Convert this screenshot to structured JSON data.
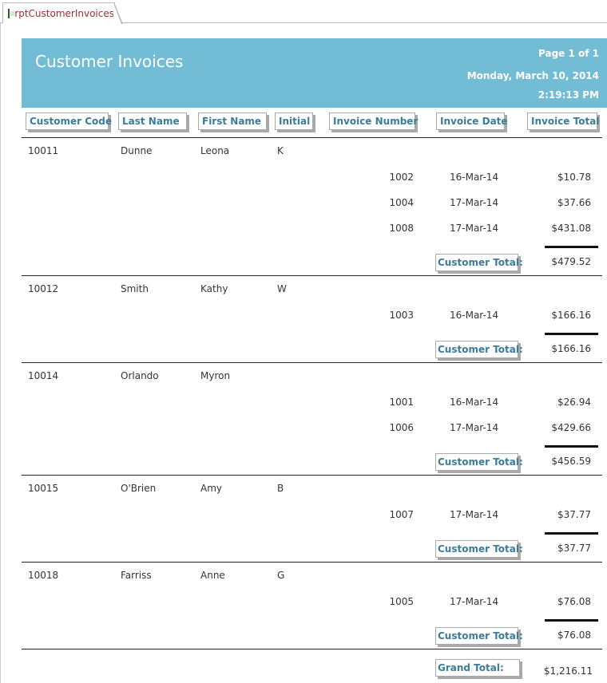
{
  "tab": {
    "label": "rptCustomerInvoices",
    "icon": "report-icon"
  },
  "header": {
    "title": "Customer Invoices",
    "page": "Page 1 of 1",
    "date": "Monday, March 10, 2014",
    "time": "2:19:13 PM",
    "banner_color": "#73bcd5"
  },
  "columns": {
    "customer_code": "Customer Code",
    "last_name": "Last Name",
    "first_name": "First Name",
    "initial": "Initial",
    "invoice_number": "Invoice Number",
    "invoice_date": "Invoice Date",
    "invoice_total": "Invoice Total"
  },
  "total_label": "Customer Total:",
  "grand_total_label": "Grand Total:",
  "grand_total": "$1,216.11",
  "customers": [
    {
      "code": "10011",
      "last": "Dunne",
      "first": "Leona",
      "initial": "K",
      "invoices": [
        {
          "number": "1002",
          "date": "16-Mar-14",
          "total": "$10.78"
        },
        {
          "number": "1004",
          "date": "17-Mar-14",
          "total": "$37.66"
        },
        {
          "number": "1008",
          "date": "17-Mar-14",
          "total": "$431.08"
        }
      ],
      "total": "$479.52"
    },
    {
      "code": "10012",
      "last": "Smith",
      "first": "Kathy",
      "initial": "W",
      "invoices": [
        {
          "number": "1003",
          "date": "16-Mar-14",
          "total": "$166.16"
        }
      ],
      "total": "$166.16"
    },
    {
      "code": "10014",
      "last": "Orlando",
      "first": "Myron",
      "initial": "",
      "invoices": [
        {
          "number": "1001",
          "date": "16-Mar-14",
          "total": "$26.94"
        },
        {
          "number": "1006",
          "date": "17-Mar-14",
          "total": "$429.66"
        }
      ],
      "total": "$456.59"
    },
    {
      "code": "10015",
      "last": "O'Brien",
      "first": "Amy",
      "initial": "B",
      "invoices": [
        {
          "number": "1007",
          "date": "17-Mar-14",
          "total": "$37.77"
        }
      ],
      "total": "$37.77"
    },
    {
      "code": "10018",
      "last": "Farriss",
      "first": "Anne",
      "initial": "G",
      "invoices": [
        {
          "number": "1005",
          "date": "17-Mar-14",
          "total": "$76.08"
        }
      ],
      "total": "$76.08"
    }
  ]
}
